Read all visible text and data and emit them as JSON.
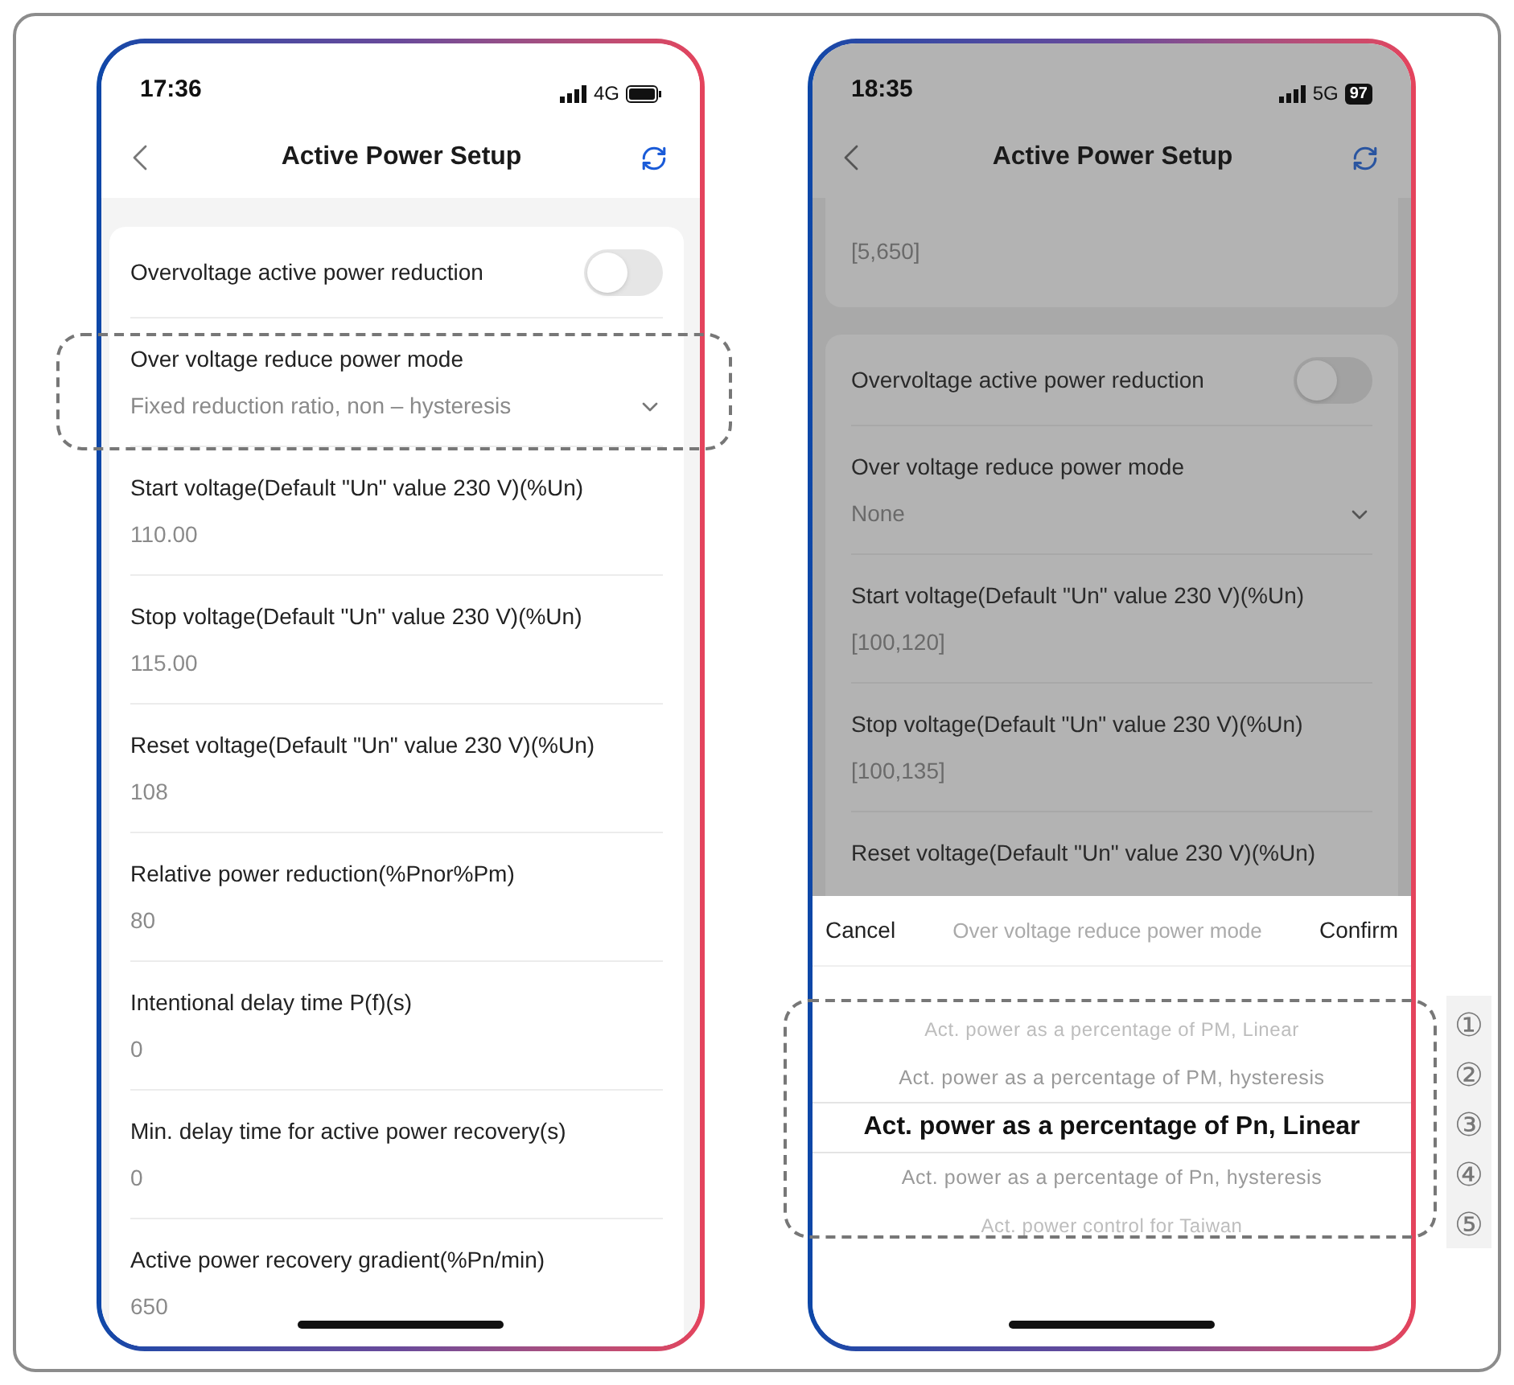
{
  "phones": [
    {
      "kind": "form",
      "status": {
        "time": "17:36",
        "network": "4G"
      },
      "title": "Active Power Setup",
      "toggle": {
        "label": "Overvoltage active power reduction",
        "on": false
      },
      "mode": {
        "label": "Over voltage reduce power mode",
        "value": "Fixed reduction ratio, non – hysteresis",
        "highlighted": true
      },
      "fields": [
        {
          "label": "Start voltage(Default \"Un\" value 230 V)(%Un)",
          "value": "110.00"
        },
        {
          "label": "Stop voltage(Default \"Un\" value 230 V)(%Un)",
          "value": "115.00"
        },
        {
          "label": "Reset voltage(Default \"Un\" value 230 V)(%Un)",
          "value": "108"
        },
        {
          "label": "Relative power reduction(%Pnor%Pm)",
          "value": "80"
        },
        {
          "label": "Intentional delay time P(f)(s)",
          "value": "0"
        },
        {
          "label": "Min. delay time for active power recovery(s)",
          "value": "0"
        },
        {
          "label": "Active power recovery gradient(%Pn/min)",
          "value": "650"
        }
      ]
    },
    {
      "kind": "picker",
      "status": {
        "time": "18:35",
        "network": "5G",
        "battery": "97"
      },
      "title": "Active Power Setup",
      "partial_value": "[5,650]",
      "toggle": {
        "label": "Overvoltage active power reduction",
        "on": false
      },
      "mode": {
        "label": "Over voltage reduce power mode",
        "value": "None"
      },
      "fields": [
        {
          "label": "Start voltage(Default \"Un\" value 230 V)(%Un)",
          "value": "[100,120]"
        },
        {
          "label": "Stop voltage(Default \"Un\" value 230 V)(%Un)",
          "value": "[100,135]"
        },
        {
          "label": "Reset voltage(Default \"Un\" value 230 V)(%Un)"
        }
      ],
      "sheet": {
        "cancel": "Cancel",
        "title": "Over voltage reduce power mode",
        "confirm": "Confirm",
        "highlighted": true,
        "options": [
          {
            "label": "Act. power as a percentage of PM, Linear",
            "selected": false
          },
          {
            "label": "Act. power as a percentage of PM, hysteresis",
            "selected": false
          },
          {
            "label": "Act. power as a percentage of Pn, Linear",
            "selected": true
          },
          {
            "label": "Act. power as a percentage of Pn, hysteresis",
            "selected": false
          },
          {
            "label": "Act. power control for Taiwan",
            "selected": false
          }
        ]
      }
    }
  ],
  "option_markers": [
    "①",
    "②",
    "③",
    "④",
    "⑤"
  ]
}
